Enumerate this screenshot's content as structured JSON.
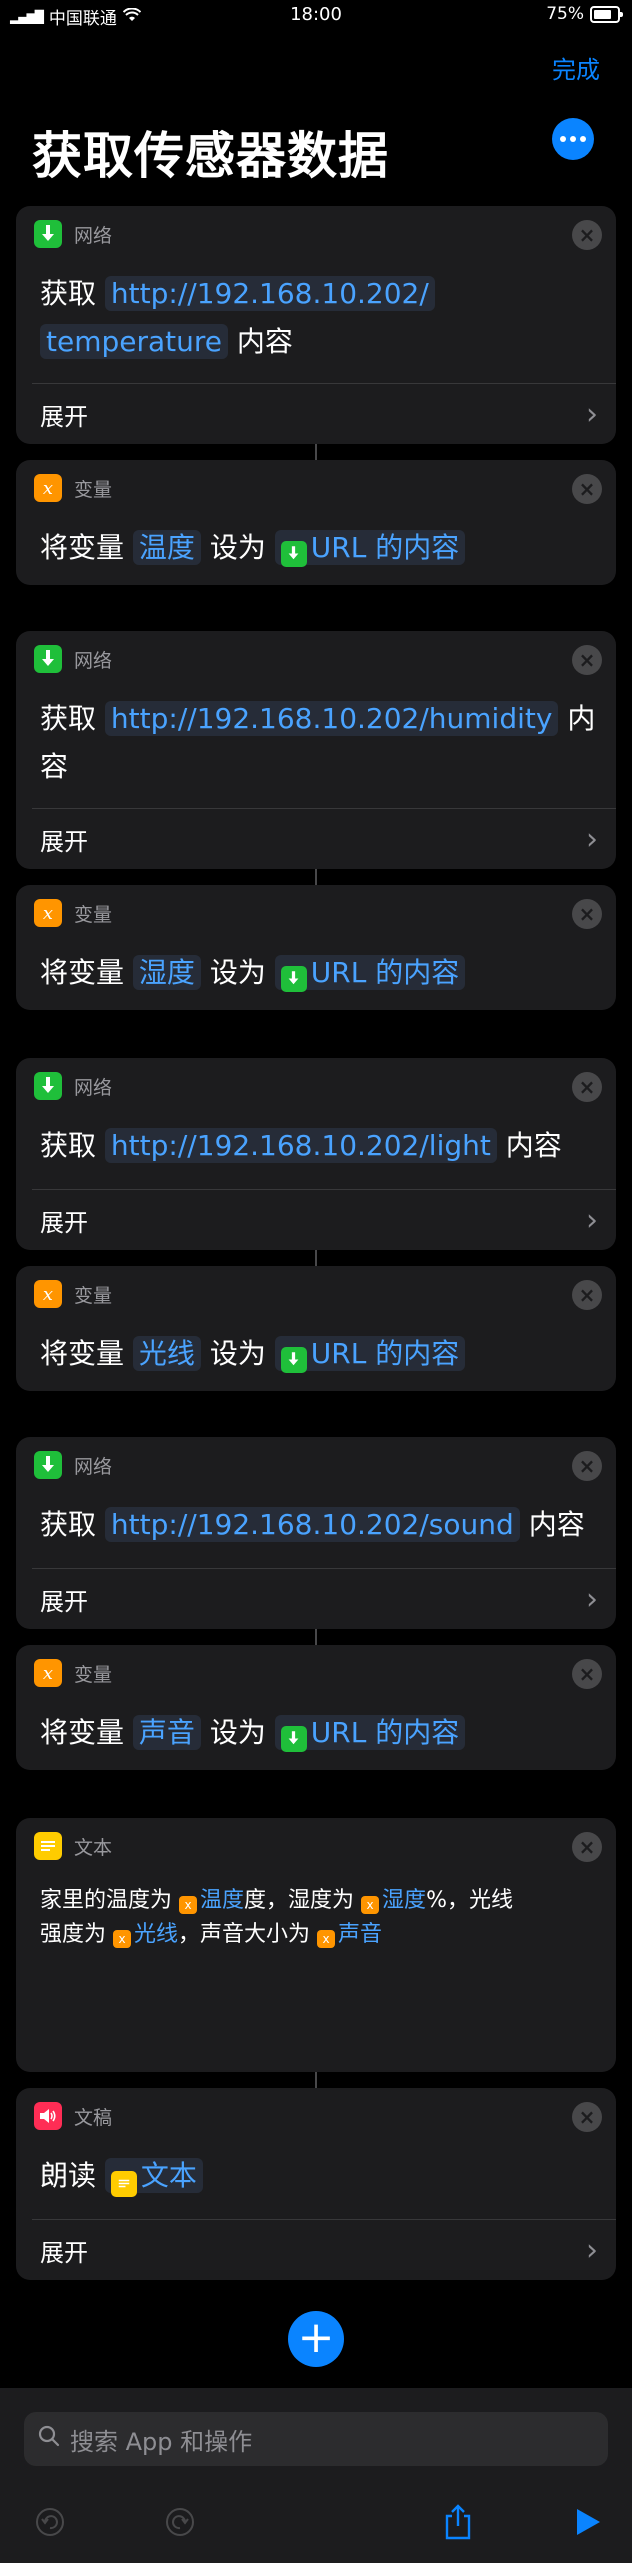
{
  "status_bar": {
    "carrier": "中国联通",
    "time": "18:00",
    "battery": "75%"
  },
  "header": {
    "done_label": "完成",
    "title": "获取传感器数据"
  },
  "common": {
    "expand_label": "展开",
    "var_prefix": "将变量",
    "var_set": "设为",
    "url_content": "URL 的内容",
    "get_label": "获取",
    "content_label": "内容"
  },
  "actions": [
    {
      "category": "网络",
      "url_part1": "http://192.168.10.202/",
      "url_part2": "temperature",
      "suffix": "内容"
    },
    {
      "category": "变量",
      "variable": "温度"
    },
    {
      "category": "网络",
      "url": "http://192.168.10.202/humidity",
      "suffix_a": "内",
      "suffix_b": "容"
    },
    {
      "category": "变量",
      "variable": "湿度"
    },
    {
      "category": "网络",
      "url": "http://192.168.10.202/light",
      "suffix": "内容"
    },
    {
      "category": "变量",
      "variable": "光线"
    },
    {
      "category": "网络",
      "url": "http://192.168.10.202/sound",
      "suffix": "内容"
    },
    {
      "category": "变量",
      "variable": "声音"
    },
    {
      "category": "文本",
      "t1": "家里的温度为",
      "v1": "温度",
      "t2": "度，湿度为",
      "v2": "湿度",
      "t3": "%，光线",
      "t4": "强度为",
      "v3": "光线",
      "t5": "，声音大小为",
      "v4": "声音"
    },
    {
      "category": "文稿",
      "speak_label": "朗读",
      "speak_token": "文本"
    }
  ],
  "search": {
    "placeholder": "搜索 App 和操作"
  },
  "toolbar": {
    "undo": "undo-icon",
    "redo": "redo-icon",
    "share": "share-icon",
    "play": "play-icon"
  },
  "colors": {
    "accent": "#0a84ff",
    "network": "#1fbf3a",
    "variable": "#ff9500",
    "text": "#ffcc00",
    "docs": "#ff2d55"
  }
}
